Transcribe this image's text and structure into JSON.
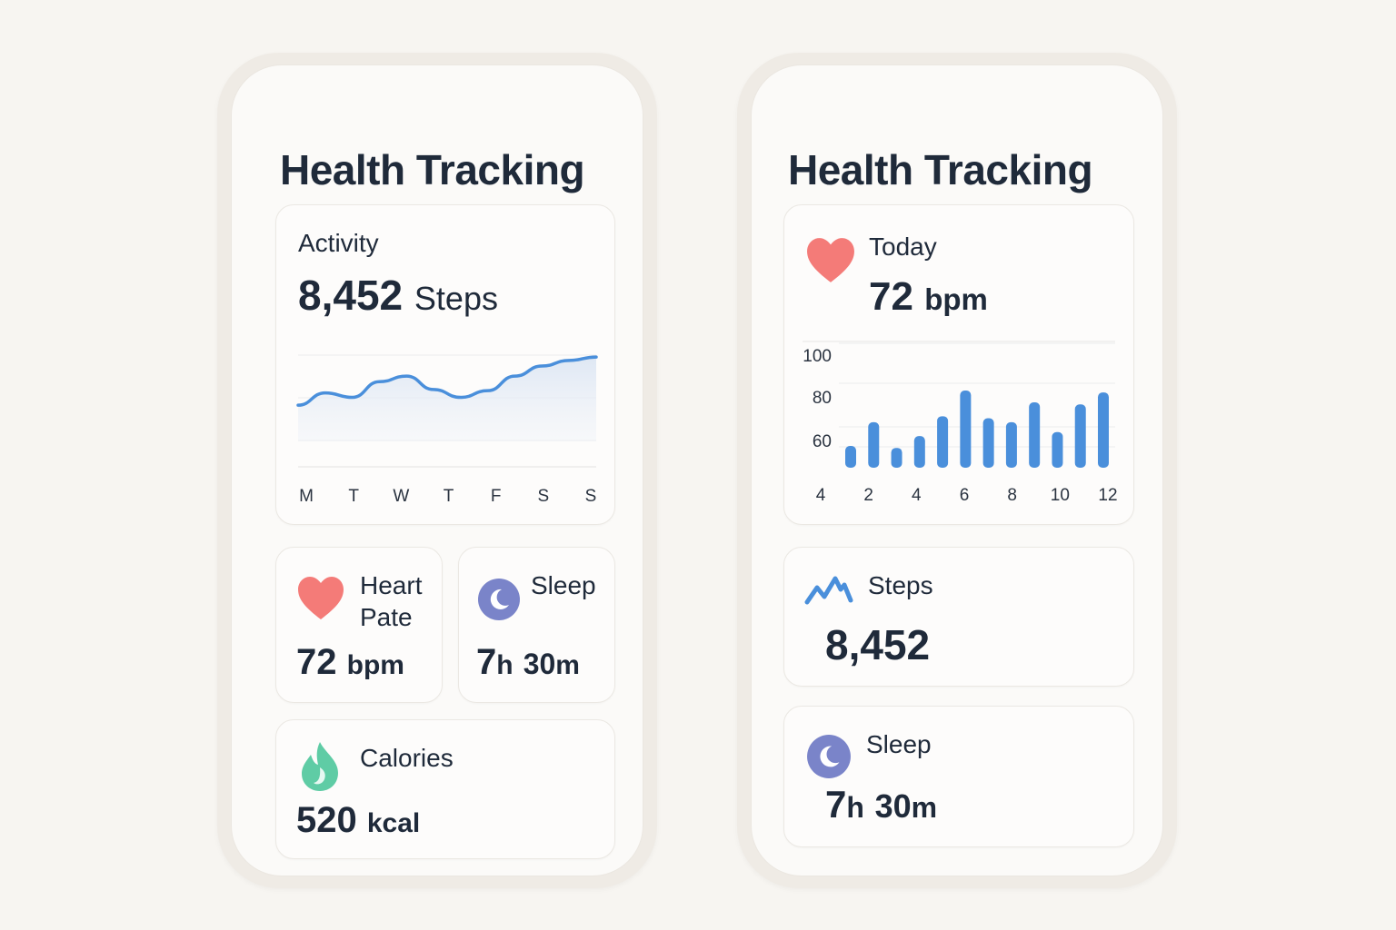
{
  "colors": {
    "text": "#1f2a3a",
    "accent_blue": "#4a8fdb",
    "heart": "#f47b78",
    "sleep": "#7a84c9",
    "calories": "#5fcca5"
  },
  "left": {
    "title": "Health Tracking",
    "activity": {
      "label": "Activity",
      "steps_value": "8,452",
      "steps_unit": "Steps",
      "days": [
        "M",
        "T",
        "W",
        "T",
        "F",
        "S",
        "S"
      ]
    },
    "heart": {
      "label_line1": "Heart",
      "label_line2": "Pate",
      "value": "72",
      "unit": "bpm",
      "icon": "heart-icon"
    },
    "sleep": {
      "label": "Sleep",
      "hours": "7",
      "h": "h",
      "minutes": "30",
      "m": "m",
      "icon": "moon-icon"
    },
    "calories": {
      "label": "Calories",
      "value": "520",
      "unit": "kcal",
      "icon": "flame-icon"
    }
  },
  "right": {
    "title": "Health Tracking",
    "today": {
      "label": "Today",
      "value": "72",
      "unit": "bpm",
      "icon": "heart-icon"
    },
    "steps": {
      "label": "Steps",
      "value": "8,452",
      "icon": "activity-zigzag-icon"
    },
    "sleep": {
      "label": "Sleep",
      "hours": "7",
      "h": "h",
      "minutes": "30",
      "m": "m",
      "icon": "moon-icon"
    }
  },
  "chart_data": [
    {
      "type": "area",
      "series": [
        {
          "values": [
            55,
            66,
            62,
            76,
            81,
            69,
            62,
            68,
            81,
            90,
            95,
            98
          ]
        }
      ],
      "x_labels": [
        "M",
        "T",
        "W",
        "T",
        "F",
        "S",
        "S"
      ],
      "ylim": [
        0,
        120
      ],
      "grid": true,
      "color": "#4a8fdb"
    },
    {
      "type": "bar",
      "x_ticks": [
        "4",
        "2",
        "4",
        "6",
        "8",
        "10",
        "12"
      ],
      "y_ticks": [
        "100",
        "80",
        "60"
      ],
      "values": [
        61,
        73,
        60,
        66,
        76,
        89,
        75,
        73,
        83,
        68,
        82,
        88
      ],
      "ylim": [
        50,
        100
      ],
      "grid": true,
      "color": "#4a8fdb"
    }
  ]
}
